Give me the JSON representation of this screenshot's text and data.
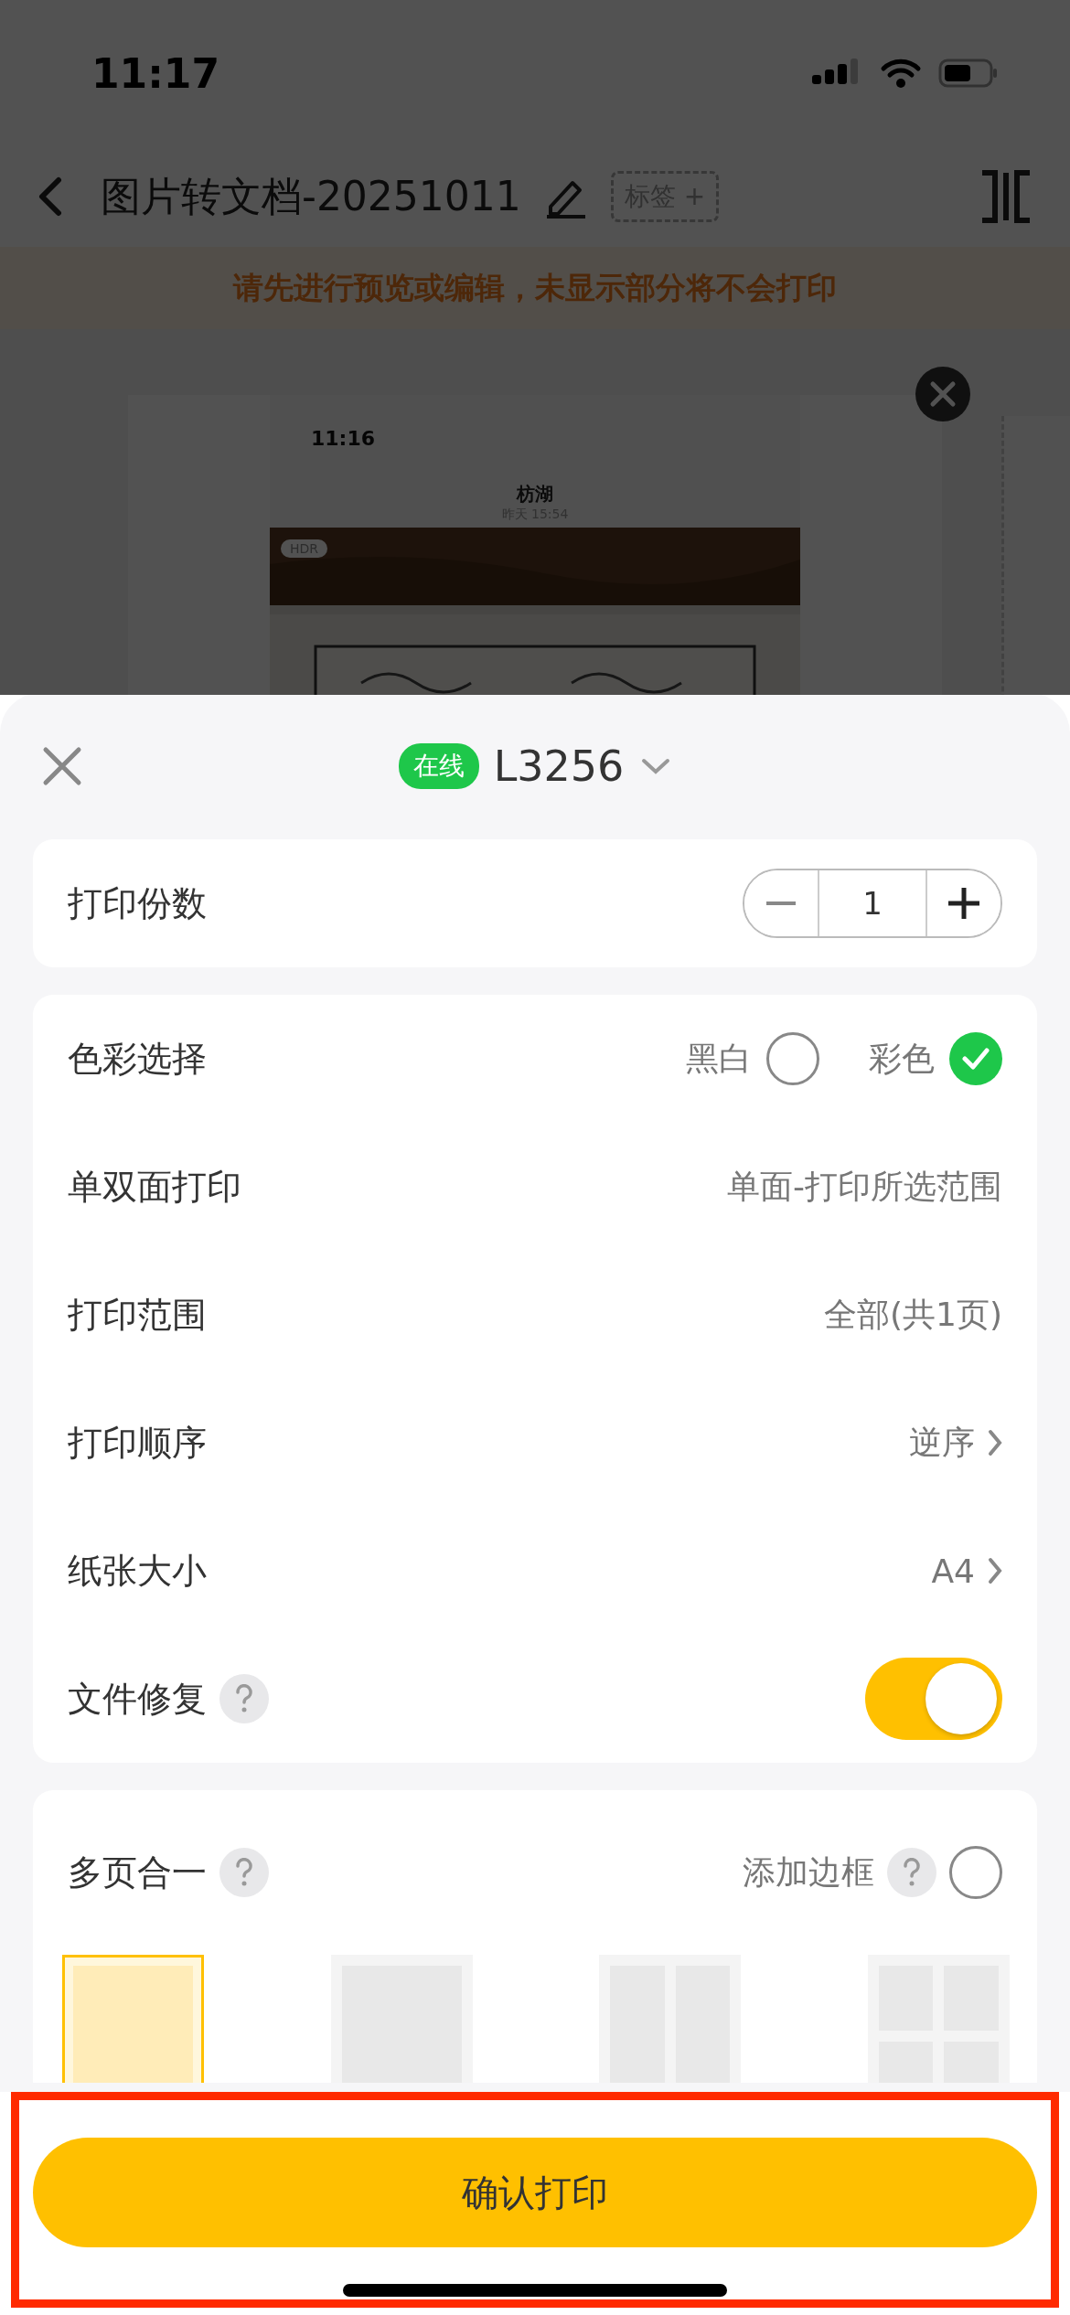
{
  "status_bar": {
    "time": "11:17"
  },
  "nav": {
    "title": "图片转文档-20251011",
    "tag_button": "标签 +"
  },
  "notice": "请先进行预览或编辑，未显示部分将不会打印",
  "preview": {
    "screenshot": {
      "time": "11:16",
      "title": "枋湖",
      "subtitle": "昨天 15:54",
      "badge": "HDR"
    }
  },
  "sheet": {
    "status_badge": "在线",
    "printer": "L3256",
    "copies": {
      "label": "打印份数",
      "value": "1"
    },
    "settings": [
      {
        "kind": "choice",
        "label": "色彩选择",
        "options": [
          {
            "label": "黑白",
            "selected": false
          },
          {
            "label": "彩色",
            "selected": true
          }
        ]
      },
      {
        "kind": "value",
        "label": "单双面打印",
        "value": "单面-打印所选范围",
        "chevron": false
      },
      {
        "kind": "value",
        "label": "打印范围",
        "value": "全部(共1页)",
        "chevron": false
      },
      {
        "kind": "value",
        "label": "打印顺序",
        "value": "逆序",
        "chevron": true
      },
      {
        "kind": "value",
        "label": "纸张大小",
        "value": "A4",
        "chevron": true
      },
      {
        "kind": "toggle",
        "label": "文件修复",
        "help": true,
        "on": true
      }
    ],
    "multipage": {
      "label": "多页合一",
      "help": true,
      "border": {
        "label": "添加边框",
        "help": true,
        "checked": false
      },
      "layouts": [
        {
          "kind": "one",
          "selected": true
        },
        {
          "kind": "two",
          "selected": false
        },
        {
          "kind": "four",
          "selected": false
        },
        {
          "kind": "six",
          "selected": false
        }
      ]
    },
    "confirm_button": "确认打印"
  }
}
